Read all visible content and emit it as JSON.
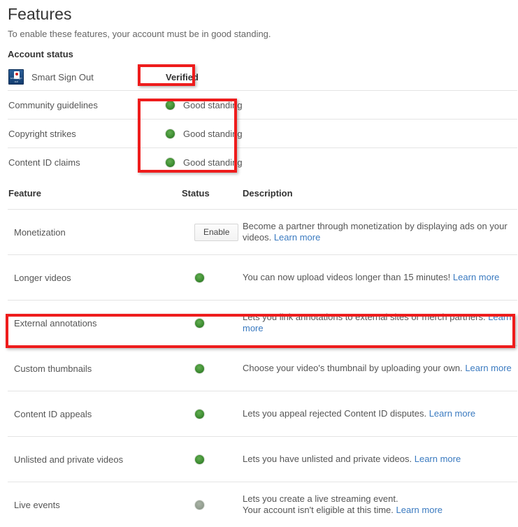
{
  "header": {
    "title": "Features",
    "subtitle": "To enable these features, your account must be in good standing."
  },
  "account_status": {
    "section_title": "Account status",
    "smart_sign_out": {
      "icon_name": "smart-sign-out-icon",
      "icon_word": "smart sign out",
      "label": "Smart Sign Out",
      "value": "Verified"
    },
    "rows": [
      {
        "label": "Community guidelines",
        "status_dot": "green",
        "status_text": "Good standing"
      },
      {
        "label": "Copyright strikes",
        "status_dot": "green",
        "status_text": "Good standing"
      },
      {
        "label": "Content ID claims",
        "status_dot": "green",
        "status_text": "Good standing"
      }
    ]
  },
  "feature_table": {
    "columns": {
      "feature": "Feature",
      "status": "Status",
      "description": "Description"
    },
    "rows": [
      {
        "feature": "Monetization",
        "status_type": "button",
        "status_label": "Enable",
        "description": "Become a partner through monetization by displaying ads on your videos.",
        "link": "Learn more"
      },
      {
        "feature": "Longer videos",
        "status_type": "dot",
        "status_dot": "green",
        "description": "You can now upload videos longer than 15 minutes!",
        "link": "Learn more"
      },
      {
        "feature": "External annotations",
        "status_type": "dot",
        "status_dot": "green",
        "description": "Lets you link annotations to external sites or merch partners.",
        "link": "Learn more"
      },
      {
        "feature": "Custom thumbnails",
        "status_type": "dot",
        "status_dot": "green",
        "description": "Choose your video's thumbnail by uploading your own.",
        "link": "Learn more"
      },
      {
        "feature": "Content ID appeals",
        "status_type": "dot",
        "status_dot": "green",
        "description": "Lets you appeal rejected Content ID disputes.",
        "link": "Learn more"
      },
      {
        "feature": "Unlisted and private videos",
        "status_type": "dot",
        "status_dot": "green",
        "description": "Lets you have unlisted and private videos.",
        "link": "Learn more"
      },
      {
        "feature": "Live events",
        "status_type": "dot",
        "status_dot": "gray",
        "description": "Lets you create a live streaming event.",
        "description_line2": "Your account isn't eligible at this time.",
        "link": "Learn more"
      }
    ]
  },
  "annotations": {
    "color": "#ee1c1c",
    "boxes": [
      {
        "name": "verified-highlight"
      },
      {
        "name": "good-standing-highlight"
      },
      {
        "name": "external-annotations-highlight"
      }
    ]
  },
  "colors": {
    "link": "#3a7ac0",
    "text": "#555555",
    "heading": "#333333",
    "divider": "#e4e4e4",
    "status_green": "#3f8e33",
    "status_gray": "#939e90",
    "annotation_red": "#ee1c1c"
  }
}
